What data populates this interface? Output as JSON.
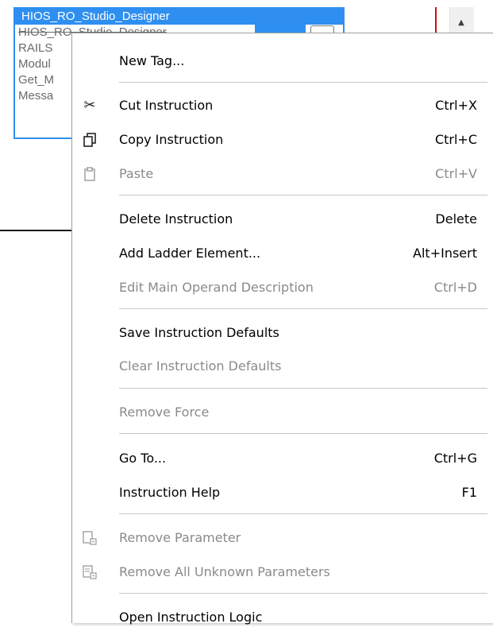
{
  "tag_list": {
    "items": [
      "HIOS_RO_Studio_Designer",
      "HIOS_RO_Studio_Designer",
      "RAILS",
      "Modul",
      "Get_M",
      "Messa"
    ],
    "partial_items": [
      "HIOS_RO_Studio_Designer",
      "RAILS",
      "Modul",
      "Get_M",
      "Messa"
    ]
  },
  "menu": {
    "new_tag": "New Tag...",
    "cut": {
      "label": "Cut Instruction",
      "shortcut": "Ctrl+X"
    },
    "copy": {
      "label": "Copy Instruction",
      "shortcut": "Ctrl+C"
    },
    "paste": {
      "label": "Paste",
      "shortcut": "Ctrl+V"
    },
    "delete": {
      "label": "Delete Instruction",
      "shortcut": "Delete"
    },
    "add_ladder": {
      "label": "Add Ladder Element...",
      "shortcut": "Alt+Insert"
    },
    "edit_operand": {
      "label": "Edit Main Operand Description",
      "shortcut": "Ctrl+D"
    },
    "save_defaults": "Save Instruction Defaults",
    "clear_defaults": "Clear Instruction Defaults",
    "remove_force": "Remove Force",
    "go_to": {
      "label": "Go To...",
      "shortcut": "Ctrl+G"
    },
    "instruction_help": {
      "label": "Instruction Help",
      "shortcut": "F1"
    },
    "remove_parameter": "Remove Parameter",
    "remove_unknown": "Remove All Unknown Parameters",
    "open_logic": "Open Instruction Logic"
  },
  "icons": {
    "cut": "scissors-icon",
    "copy": "copy-icon",
    "paste": "paste-icon",
    "remove_parameter": "remove-parameter-icon",
    "remove_unknown": "remove-unknown-parameters-icon"
  },
  "colors": {
    "selection": "#2f8ff0",
    "disabled_text": "#8a8a8a",
    "rung_marker": "#d01010"
  }
}
